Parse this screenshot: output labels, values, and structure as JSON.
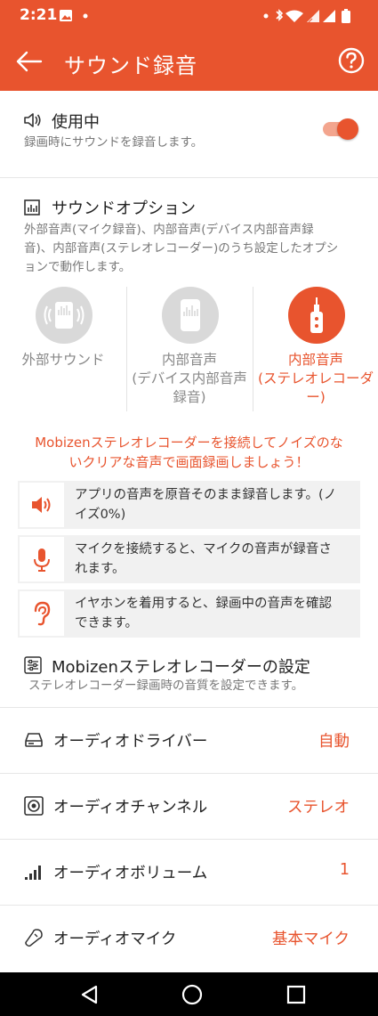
{
  "status_bar": {
    "time": "2:21",
    "left_icons": [
      "image-icon",
      "dot-icon"
    ],
    "right_icons": [
      "dot-icon",
      "bluetooth-icon",
      "wifi-icon",
      "signal-icon",
      "signal-icon",
      "battery-icon"
    ]
  },
  "app_bar": {
    "title": "サウンド録音",
    "back_icon": "arrow-left-icon",
    "help_icon": "help-icon"
  },
  "use_section": {
    "title": "使用中",
    "subtitle": "録画時にサウンドを録音します。",
    "toggle_on": true
  },
  "sound_options": {
    "title": "サウンドオプション",
    "description_lines": [
      "外部音声(マイク録音)、内部音声(デバイス内部音声録",
      "音)、内部音声(ステレオレコーダー)のうち設定したオプシ",
      "ョンで動作します。"
    ],
    "options": [
      {
        "label_lines": [
          "外部サウンド"
        ],
        "selected": false
      },
      {
        "label_lines": [
          "内部音声",
          "(デバイス内部音声",
          "録音)"
        ],
        "selected": false
      },
      {
        "label_lines": [
          "内部音声",
          "(ステレオレコーダ",
          "ー)"
        ],
        "selected": true
      }
    ]
  },
  "promo_lines": [
    "Mobizenステレオレコーダーを接続してノイズのな",
    "いクリアな音声で画面録画しましょう！"
  ],
  "features": [
    {
      "icon": "speaker-icon",
      "lines": [
        "アプリの音声を原音そのまま録音します。(ノ",
        "イズ0%)"
      ]
    },
    {
      "icon": "microphone-icon",
      "lines": [
        "マイクを接続すると、マイクの音声が録音さ",
        "れます。"
      ]
    },
    {
      "icon": "ear-icon",
      "lines": [
        "イヤホンを着用すると、録画中の音声を確認",
        "できます。"
      ]
    }
  ],
  "stereo_settings": {
    "title": "Mobizenステレオレコーダーの設定",
    "subtitle": "ステレオレコーダー録画時の音質を設定できます。"
  },
  "settings_rows": [
    {
      "label": "オーディオドライバー",
      "value": "自動",
      "icon": "drive-icon"
    },
    {
      "label": "オーディオチャンネル",
      "value": "ステレオ",
      "icon": "speaker-box-icon"
    },
    {
      "label": "オーディオボリューム",
      "value": "1",
      "icon": "volume-bars-icon"
    },
    {
      "label": "オーディオマイク",
      "value": "基本マイク",
      "icon": "microphone-outline-icon"
    }
  ],
  "colors": {
    "accent": "#E8542E",
    "toggle_track": "#F3A58E",
    "feature_bg": "#F1F1F1",
    "inactive_circle": "#D9D9D9"
  }
}
